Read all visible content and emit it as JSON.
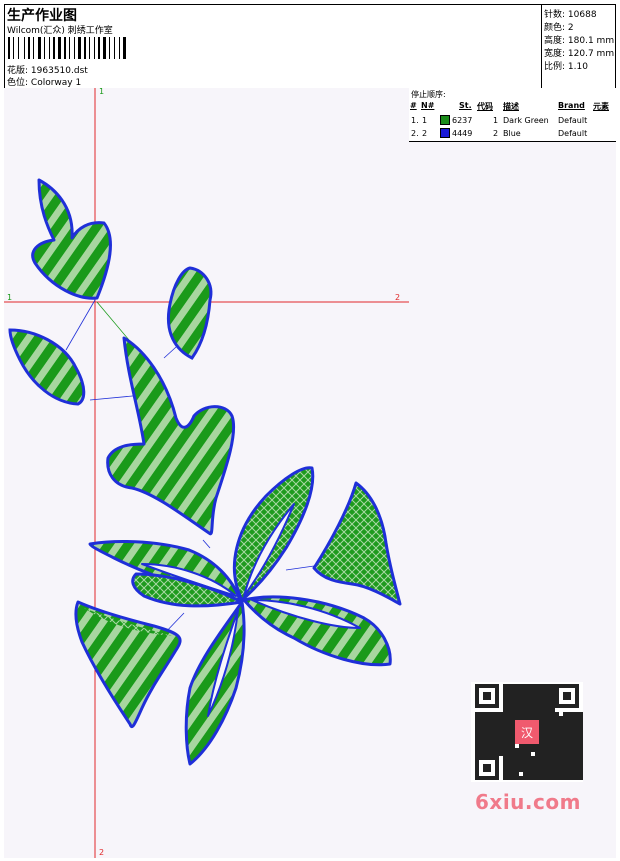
{
  "header": {
    "title": "生产作业图",
    "studio": "Wilcom(汇众) 刺绣工作室",
    "design_label": "花版:",
    "design_value": "1963510.dst",
    "colorway_label": "色位:",
    "colorway_value": "Colorway 1"
  },
  "specs": {
    "stitches_label": "针数:",
    "stitches_value": "10688",
    "colors_label": "颜色:",
    "colors_value": "2",
    "height_label": "高度:",
    "height_value": "180.1 mm",
    "width_label": "宽度:",
    "width_value": "120.7 mm",
    "ratio_label": "比例:",
    "ratio_value": "1.10"
  },
  "canvas": {
    "marker_top": "1",
    "marker_bottom": "2",
    "marker_left": "1",
    "marker_right": "2"
  },
  "stop_sequence": {
    "label": "停止顺序:",
    "columns": [
      "#",
      "N#",
      "St.",
      "代码",
      "描述",
      "Brand",
      "元素"
    ],
    "rows": [
      {
        "num": "1.",
        "needle": "1",
        "stitches": "6237",
        "code": "1",
        "desc": "Dark Green",
        "brand": "Default",
        "color": "#1a8c1a"
      },
      {
        "num": "2.",
        "needle": "2",
        "stitches": "4449",
        "code": "2",
        "desc": "Blue",
        "brand": "Default",
        "color": "#1a1ad6"
      }
    ]
  },
  "watermark": {
    "text": "6xiu.com",
    "seal": "汉"
  },
  "colors": {
    "green": "#1a9a1a",
    "blue": "#1f2fd8",
    "guide": "#e0282a"
  }
}
